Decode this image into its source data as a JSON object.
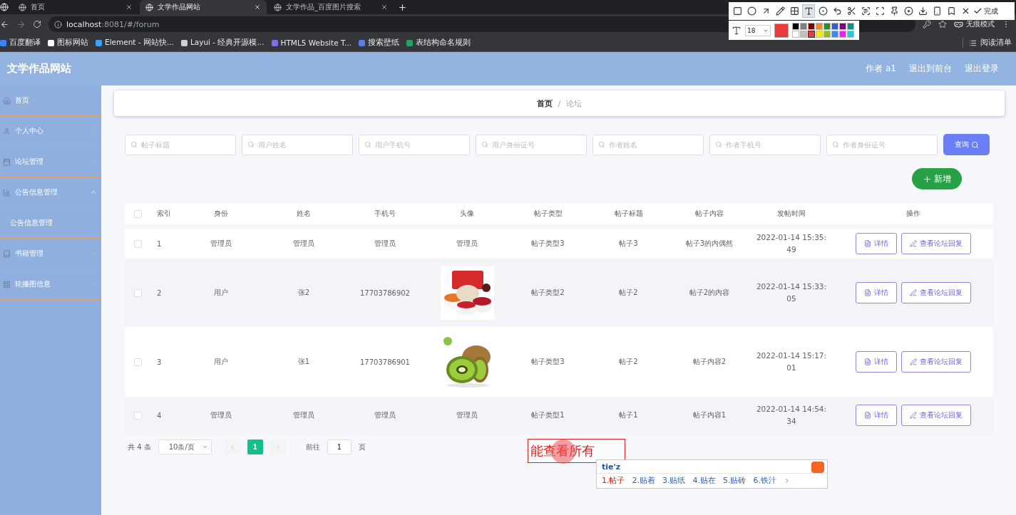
{
  "browser": {
    "tabs": [
      {
        "title": "首页",
        "selected": false
      },
      {
        "title": "文学作品网站",
        "selected": true
      },
      {
        "title": "文学作品_百度图片搜索",
        "selected": false
      }
    ],
    "address": {
      "host": "localhost",
      "path": ":8081/#/forum"
    },
    "incognito_label": "无痕模式",
    "bookmarks": [
      {
        "label": "百度翻译",
        "color": "#3b82f6"
      },
      {
        "label": "图标网站",
        "color": "#ffffff"
      },
      {
        "label": "Element - 网站快...",
        "color": "#409eff"
      },
      {
        "label": "Layui - 经典开源模...",
        "color": "#d0d0d0"
      },
      {
        "label": "HTML5 Website T...",
        "color": "#7c6cf0"
      },
      {
        "label": "搜索壁纸",
        "color": "#5a7cf0"
      },
      {
        "label": "表结构命名规则",
        "color": "#1fa463"
      }
    ],
    "reading_list": "阅读清单"
  },
  "annotation_toolbar": {
    "tools": [
      {
        "kind": "rect",
        "selected": false
      },
      {
        "kind": "circle",
        "selected": false
      },
      {
        "kind": "arrow",
        "selected": false
      },
      {
        "kind": "pencil",
        "selected": false
      },
      {
        "kind": "mosaic",
        "selected": false
      },
      {
        "kind": "text",
        "selected": true
      },
      {
        "kind": "number",
        "selected": false
      },
      {
        "kind": "undo",
        "selected": false
      },
      {
        "kind": "cut",
        "selected": false
      },
      {
        "kind": "ocr",
        "selected": false
      },
      {
        "kind": "scan",
        "selected": false
      },
      {
        "kind": "pin",
        "selected": false
      },
      {
        "kind": "record",
        "selected": false
      },
      {
        "kind": "download",
        "selected": false
      },
      {
        "kind": "phone",
        "selected": false
      },
      {
        "kind": "bookmark",
        "selected": false
      },
      {
        "kind": "close",
        "selected": false
      }
    ],
    "done": "完成",
    "font_size": "18",
    "palette": [
      {
        "color": "#000000",
        "selected": false
      },
      {
        "color": "#808080",
        "selected": false
      },
      {
        "color": "#800000",
        "selected": false
      },
      {
        "color": "#f08a30",
        "selected": false
      },
      {
        "color": "#2e8b2e",
        "selected": false
      },
      {
        "color": "#3060d0",
        "selected": false
      },
      {
        "color": "#800080",
        "selected": false
      },
      {
        "color": "#108f8f",
        "selected": false
      },
      {
        "color": "#ffffff",
        "selected": false
      },
      {
        "color": "#c0c0c0",
        "selected": false
      },
      {
        "color": "#e83a3a",
        "selected": true
      },
      {
        "color": "#f0f000",
        "selected": false
      },
      {
        "color": "#90c020",
        "selected": false
      },
      {
        "color": "#3090f0",
        "selected": false
      },
      {
        "color": "#f020f0",
        "selected": false
      },
      {
        "color": "#20d0d0",
        "selected": false
      }
    ]
  },
  "app": {
    "title": "文学作品网站",
    "user": "作者 a1",
    "links": [
      "退出到前台",
      "退出登录"
    ]
  },
  "sidebar": {
    "items": [
      {
        "label": "首页"
      },
      {
        "label": "个人中心",
        "expanded": false
      },
      {
        "label": "论坛管理",
        "expanded": false
      },
      {
        "label": "公告信息管理",
        "expanded": true,
        "children": [
          {
            "label": "公告信息管理"
          }
        ]
      },
      {
        "label": "书籍管理",
        "expanded": false
      },
      {
        "label": "轮播图信息",
        "expanded": false
      }
    ]
  },
  "breadcrumb": {
    "items": [
      "首页",
      "论坛"
    ],
    "separator": "/"
  },
  "search": {
    "fields": [
      {
        "placeholder": "帖子标题"
      },
      {
        "placeholder": "用户姓名"
      },
      {
        "placeholder": "用户手机号"
      },
      {
        "placeholder": "用户身份证号"
      },
      {
        "placeholder": "作者姓名"
      },
      {
        "placeholder": "作者手机号"
      },
      {
        "placeholder": "作者身份证号"
      }
    ],
    "button": "查询"
  },
  "add_button": "新增",
  "table": {
    "all_checked": false,
    "columns": [
      "索引",
      "身份",
      "姓名",
      "手机号",
      "头像",
      "帖子类型",
      "帖子标题",
      "帖子内容",
      "发帖时间",
      "操作"
    ],
    "rows": [
      {
        "checked": false,
        "index": "1",
        "identity": "管理员",
        "name": "管理员",
        "phone": "管理员",
        "avatar": {
          "kind": "text",
          "text": "管理员"
        },
        "type": "帖子类型3",
        "title": "帖子3",
        "content": "帖子3的内偶然",
        "time": "2022-01-14 15:35:49",
        "actions": [
          "详情",
          "查看论坛回复"
        ]
      },
      {
        "checked": false,
        "index": "2",
        "identity": "用户",
        "name": "张2",
        "phone": "17703786902",
        "avatar": {
          "kind": "picture"
        },
        "type": "帖子类型2",
        "title": "帖子2",
        "content": "帖子2的内容",
        "time": "2022-01-14 15:33:05",
        "actions": [
          "详情",
          "查看论坛回复"
        ]
      },
      {
        "checked": false,
        "index": "3",
        "identity": "用户",
        "name": "张1",
        "phone": "17703786901",
        "avatar": {
          "kind": "picture"
        },
        "type": "帖子类型3",
        "title": "帖子2",
        "content": "帖子内容2",
        "time": "2022-01-14 15:17:01",
        "actions": [
          "详情",
          "查看论坛回复"
        ]
      },
      {
        "checked": false,
        "index": "4",
        "identity": "管理员",
        "name": "管理员",
        "phone": "管理员",
        "avatar": {
          "kind": "text",
          "text": "管理员"
        },
        "type": "帖子类型1",
        "title": "帖子1",
        "content": "帖子内容1",
        "time": "2022-01-14 14:54:34",
        "actions": [
          "详情",
          "查看论坛回复"
        ]
      }
    ]
  },
  "pagination": {
    "total": "共 4 条",
    "page_size": "10条/页",
    "pages": [
      {
        "label": "1",
        "selected": true
      }
    ],
    "goto_label": "前往",
    "goto_value": "1",
    "page_suffix": "页"
  },
  "annotation": {
    "text": "能查看所有"
  },
  "ime": {
    "input": "tie'z",
    "candidates": [
      {
        "label": "1.帖子",
        "selected": true
      },
      {
        "label": "2.贴着",
        "selected": false
      },
      {
        "label": "3.贴纸",
        "selected": false
      },
      {
        "label": "4.贴在",
        "selected": false
      },
      {
        "label": "5.贴砖",
        "selected": false
      },
      {
        "label": "6.铁汁",
        "selected": false
      }
    ]
  }
}
